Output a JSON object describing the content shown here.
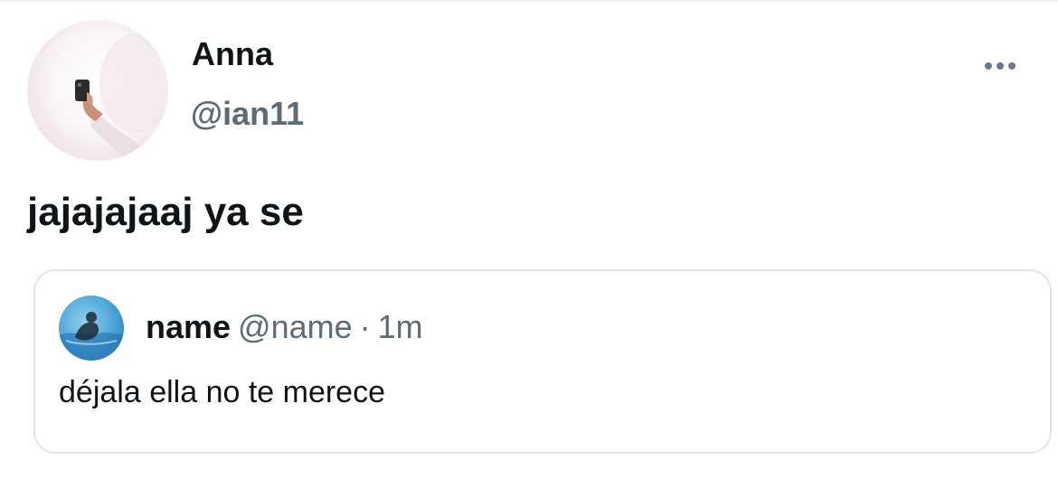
{
  "tweet": {
    "author": {
      "display_name": "Anna",
      "handle": "@ian11",
      "avatar_icon": "avatar-photo"
    },
    "more_icon": "more-horizontal-icon",
    "text": "jajajajaaj ya se"
  },
  "quoted_tweet": {
    "author": {
      "display_name": "name",
      "handle": "@name",
      "avatar_icon": "avatar-photo"
    },
    "separator": "·",
    "time": "1m",
    "text": "déjala ella no te merece"
  },
  "colors": {
    "text_primary": "#0f1419",
    "text_secondary": "#5b6b78",
    "card_border": "#dfe4e8"
  }
}
